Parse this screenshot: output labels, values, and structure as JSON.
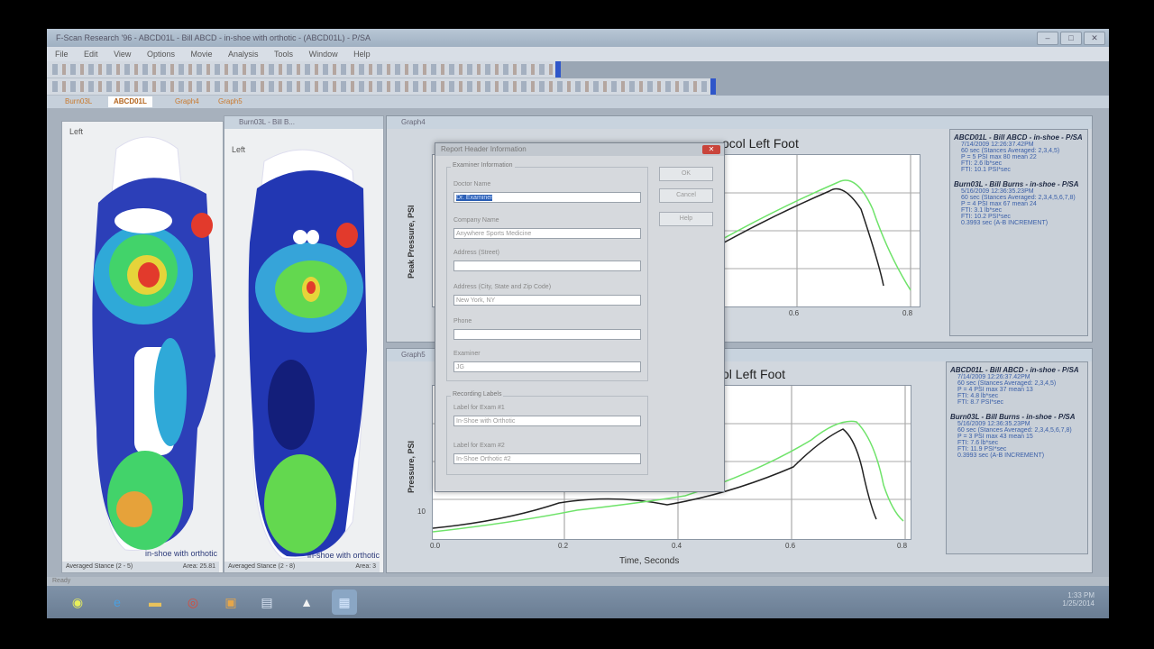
{
  "app": {
    "title": "F-Scan Research '96 - ABCD01L - Bill ABCD - in-shoe with orthotic - (ABCD01L) - P/SA",
    "menu": [
      "File",
      "Edit",
      "View",
      "Options",
      "Movie",
      "Analysis",
      "Tools",
      "Window",
      "Help"
    ],
    "tabs": [
      "Burn03L",
      "ABCD01L",
      "Graph4",
      "Graph5"
    ],
    "status": "Ready"
  },
  "foot_panels": [
    {
      "title": "",
      "side": "Left",
      "caption": "in-shoe with orthotic",
      "status_left": "Averaged Stance (2 - 5)",
      "status_right": "Area: 25.81"
    },
    {
      "title": "Burn03L - Bill B...",
      "side": "Left",
      "caption": "in-shoe with orthotic",
      "status_left": "Averaged Stance (2 - 8)",
      "status_right": "Area: 3"
    }
  ],
  "graphs": [
    {
      "window_title": "Graph4",
      "title_visible": "ocol Left Foot",
      "ylabel": "Peak Pressure, PSI",
      "xticks": [
        "0.6",
        "0.8"
      ],
      "legend": [
        {
          "header": "ABCD01L - Bill ABCD - in-shoe - P/SA",
          "lines": [
            "7/14/2009 12:26:37.42PM",
            "60 sec (Stances Averaged: 2,3,4,5)",
            "P = 5 PSI max 80 mean 22",
            "FTI: 2.6 lb*sec",
            "FTI: 10.1 PSI*sec"
          ]
        },
        {
          "header": "Burn03L - Bill Burns - in-shoe - P/SA",
          "lines": [
            "5/16/2009 12:36:35.23PM",
            "60 sec (Stances Averaged: 2,3,4,5,6,7,8)",
            "P = 4 PSI max 67 mean 24",
            "FTI: 3.1 lb*sec",
            "FTI: 10.2 PSI*sec",
            "0.3993 sec (A-B INCREMENT)"
          ]
        }
      ]
    },
    {
      "window_title": "Graph5",
      "title_visible": "ol Left Foot",
      "ylabel": "Pressure, PSI",
      "xticks": [
        "0.0",
        "0.2",
        "0.4",
        "0.6",
        "0.8"
      ],
      "ytick": "10",
      "xlabel": "Time, Seconds",
      "legend": [
        {
          "header": "ABCD01L - Bill ABCD - in-shoe - P/SA",
          "lines": [
            "7/14/2009 12:26:37.42PM",
            "60 sec (Stances Averaged: 2,3,4,5)",
            "P = 4 PSI max 37 mean 13",
            "FTI: 4.8 lb*sec",
            "FTI: 8.7 PSI*sec"
          ]
        },
        {
          "header": "Burn03L - Bill Burns - in-shoe - P/SA",
          "lines": [
            "5/16/2009 12:36:35.23PM",
            "60 sec (Stances Averaged: 2,3,4,5,6,7,8)",
            "P = 3 PSI max 43 mean 15",
            "FTI: 7.6 lb*sec",
            "FTI: 11.9 PSI*sec",
            "0.3993 sec (A-B INCREMENT)"
          ]
        }
      ]
    }
  ],
  "dialog": {
    "title": "Report Header Information",
    "examiner_group": "Examiner Information",
    "fields": [
      {
        "label": "Doctor Name",
        "value": "Dr. Examiner"
      },
      {
        "label": "Company Name",
        "value": "Anywhere Sports Medicine"
      },
      {
        "label": "Address (Street)",
        "value": ""
      },
      {
        "label": "Address (City, State and Zip Code)",
        "value": "New York, NY"
      },
      {
        "label": "Phone",
        "value": ""
      },
      {
        "label": "Examiner",
        "value": "JG"
      }
    ],
    "recording_group": "Recording Labels",
    "recording_fields": [
      {
        "label": "Label for Exam #1",
        "value": "In-Shoe with Orthotic"
      },
      {
        "label": "Label for Exam #2",
        "value": "In-Shoe Orthotic #2"
      }
    ],
    "buttons": {
      "ok": "OK",
      "cancel": "Cancel",
      "help": "Help"
    }
  },
  "taskbar": {
    "clock_time": "1:33 PM",
    "clock_date": "1/25/2014"
  },
  "colors": {
    "series_black": "#222222",
    "series_green": "#6fe36a"
  }
}
